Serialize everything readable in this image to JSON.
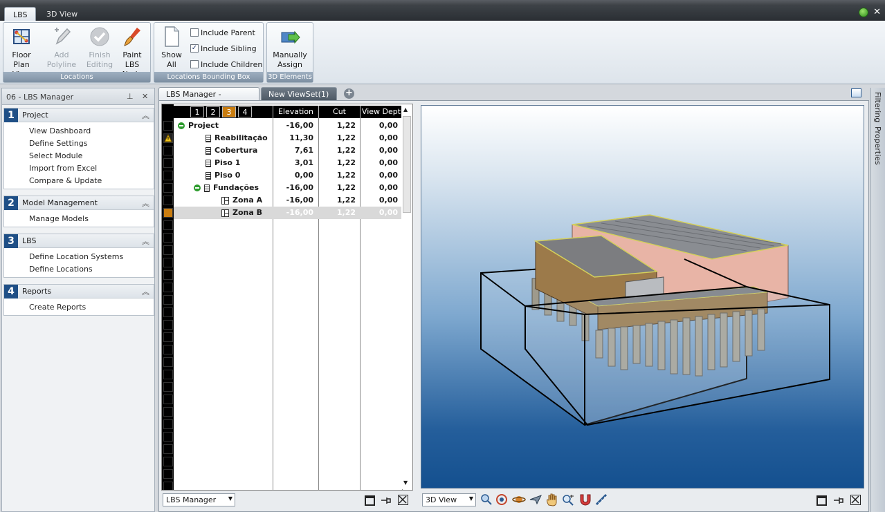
{
  "ribbon_tabs": [
    "LBS",
    "3D View"
  ],
  "ribbon": {
    "groups": [
      {
        "label": "Locations",
        "buttons": [
          {
            "label": "Floor Plan View",
            "line1": "Floor",
            "line2": "Plan View",
            "enabled": true
          },
          {
            "label": "Add Polyline",
            "line1": "Add Polyline",
            "line2": "",
            "enabled": false
          },
          {
            "label": "Finish Editing",
            "line1": "Finish",
            "line2": "Editing",
            "enabled": false
          },
          {
            "label": "Paint LBS Node",
            "line1": "Paint",
            "line2": "LBS Node",
            "enabled": true
          }
        ]
      },
      {
        "label": "Locations Bounding Box",
        "buttons": [
          {
            "label": "Show All",
            "line1": "Show All",
            "line2": "",
            "enabled": true
          }
        ],
        "checkboxes": [
          {
            "label": "Include Parent",
            "checked": false
          },
          {
            "label": "Include Sibling",
            "checked": true
          },
          {
            "label": "Include Children",
            "checked": false
          }
        ]
      },
      {
        "label": "3D Elements",
        "buttons": [
          {
            "label": "Manually Assign",
            "line1": "Manually",
            "line2": "Assign",
            "enabled": true
          }
        ]
      }
    ]
  },
  "left_panel": {
    "title": "06 - LBS Manager",
    "sections": [
      {
        "num": "1",
        "title": "Project",
        "items": [
          "View Dashboard",
          "Define Settings",
          "Select Module",
          "Import from Excel",
          "Compare & Update"
        ]
      },
      {
        "num": "2",
        "title": "Model Management",
        "items": [
          "Manage Models"
        ]
      },
      {
        "num": "3",
        "title": "LBS",
        "items": [
          "Define Location Systems",
          "Define Locations"
        ]
      },
      {
        "num": "4",
        "title": "Reports",
        "items": [
          "Create Reports"
        ]
      }
    ]
  },
  "doc_tabs": [
    "LBS Manager - Modified",
    "New ViewSet(1)"
  ],
  "tree": {
    "levels": [
      "1",
      "2",
      "3",
      "4"
    ],
    "active_level": "3",
    "columns": [
      "Elevation",
      "Cut",
      "View Dept"
    ],
    "rows": [
      {
        "name": "Project",
        "icon": "collapse-icon",
        "indent": 0,
        "elevation": "-16,00",
        "cut": "1,22",
        "view_depth": "0,00",
        "warning": false,
        "selected": false
      },
      {
        "name": "Reabilitação",
        "icon": "floor-icon",
        "indent": 2,
        "elevation": "11,30",
        "cut": "1,22",
        "view_depth": "0,00",
        "warning": true,
        "selected": false
      },
      {
        "name": "Cobertura",
        "icon": "floor-icon",
        "indent": 2,
        "elevation": "7,61",
        "cut": "1,22",
        "view_depth": "0,00",
        "warning": false,
        "selected": false
      },
      {
        "name": "Piso 1",
        "icon": "floor-icon",
        "indent": 2,
        "elevation": "3,01",
        "cut": "1,22",
        "view_depth": "0,00",
        "warning": false,
        "selected": false
      },
      {
        "name": "Piso 0",
        "icon": "floor-icon",
        "indent": 2,
        "elevation": "0,00",
        "cut": "1,22",
        "view_depth": "0,00",
        "warning": false,
        "selected": false
      },
      {
        "name": "Fundações",
        "icon": "floor-icon",
        "indent": 1,
        "elevation": "-16,00",
        "cut": "1,22",
        "view_depth": "0,00",
        "warning": false,
        "selected": false,
        "collapsible": true
      },
      {
        "name": "Zona A",
        "icon": "zone-icon",
        "indent": 3,
        "elevation": "-16,00",
        "cut": "1,22",
        "view_depth": "0,00",
        "warning": false,
        "selected": false
      },
      {
        "name": "Zona B",
        "icon": "zone-icon",
        "indent": 3,
        "elevation": "-16,00",
        "cut": "1,22",
        "view_depth": "0,00",
        "warning": false,
        "selected": true
      }
    ]
  },
  "tree_toolbar": {
    "combo": "LBS Manager"
  },
  "view_toolbar": {
    "combo": "3D View"
  },
  "right_strip": [
    "Filtering",
    "Properties"
  ],
  "colors": {
    "accent_orange": "#c97d10",
    "section_blue": "#1f4f86",
    "view_bg_bottom": "#14508f"
  }
}
